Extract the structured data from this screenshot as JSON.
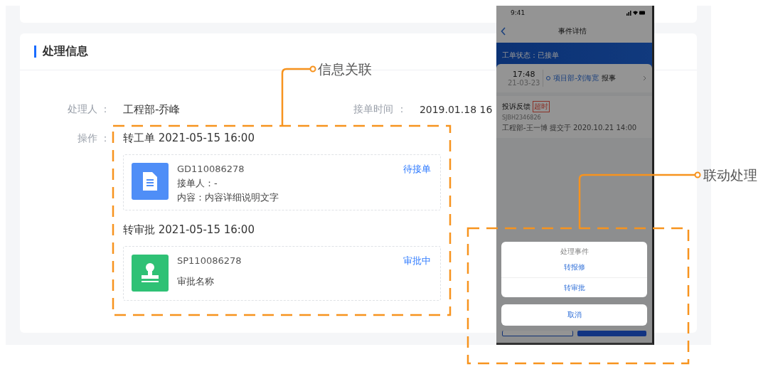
{
  "section": {
    "title": "处理信息"
  },
  "fields": [
    {
      "label": "处理人 ：",
      "value": "工程部-乔峰"
    },
    {
      "label": "接单时间 ：",
      "value": "2019.01.18 16"
    }
  ],
  "operations": {
    "label": "操作 ：",
    "records": [
      {
        "kind": "work_order",
        "title": "转工单 2021-05-15 16:00",
        "code": "GD110086278",
        "status": "待接单",
        "lines": [
          "接单人：-",
          "内容：内容详细说明文字"
        ]
      },
      {
        "kind": "approval",
        "title": "转审批 2021-05-15 16:00",
        "code": "SP110086278",
        "status": "审批中",
        "lines": [
          "审批名称"
        ]
      }
    ]
  },
  "annotations": [
    {
      "text": "信息关联"
    },
    {
      "text": "联动处理"
    }
  ],
  "phone": {
    "time": "9:41",
    "title": "事件详情",
    "status_banner": "工单状态：已接单",
    "timeline": {
      "time": "17:48",
      "date": "21-03-23",
      "actor": "项目部-刘海宽",
      "action": "报事"
    },
    "event": {
      "title": "投诉反馈",
      "tag": "超时",
      "code": "SJBH2346826",
      "meta": "工程部-王一博 提交于 2020.10.21 14:00"
    },
    "action_sheet": {
      "title": "处理事件",
      "actions": [
        "转报修",
        "转审批"
      ],
      "cancel": "取消"
    }
  }
}
